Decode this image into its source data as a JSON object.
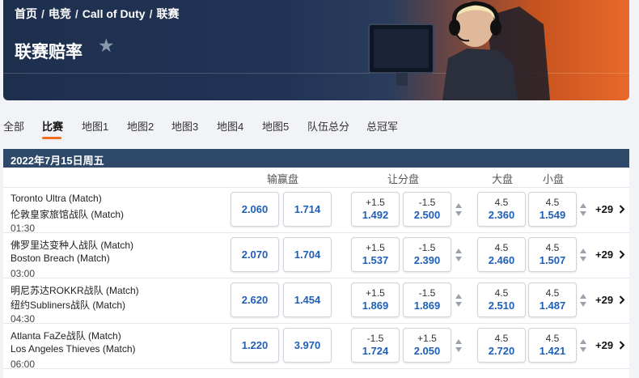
{
  "breadcrumb": [
    "首页",
    "电竞",
    "Call of Duty",
    "联赛"
  ],
  "breadcrumb_separator": "/",
  "page_title": "联赛赔率",
  "tabs": [
    "全部",
    "比赛",
    "地图1",
    "地图2",
    "地图3",
    "地图4",
    "地图5",
    "队伍总分",
    "总冠军"
  ],
  "active_tab": "比赛",
  "date_label": "2022年7月15日周五",
  "columns": {
    "moneyline": "输赢盘",
    "handicap": "让分盘",
    "over": "大盘",
    "under": "小盘"
  },
  "matches": [
    {
      "home": "Toronto Ultra (Match)",
      "away": "伦敦皇家旅馆战队 (Match)",
      "time": "01:30",
      "ml": [
        "2.060",
        "1.714"
      ],
      "hcp": [
        {
          "line": "+1.5",
          "odds": "1.492"
        },
        {
          "line": "-1.5",
          "odds": "2.500"
        }
      ],
      "over": {
        "line": "4.5",
        "odds": "2.360"
      },
      "under": {
        "line": "4.5",
        "odds": "1.549"
      },
      "more": "+29"
    },
    {
      "home": "佛罗里达变种人战队 (Match)",
      "away": "Boston Breach (Match)",
      "time": "03:00",
      "ml": [
        "2.070",
        "1.704"
      ],
      "hcp": [
        {
          "line": "+1.5",
          "odds": "1.537"
        },
        {
          "line": "-1.5",
          "odds": "2.390"
        }
      ],
      "over": {
        "line": "4.5",
        "odds": "2.460"
      },
      "under": {
        "line": "4.5",
        "odds": "1.507"
      },
      "more": "+29"
    },
    {
      "home": "明尼苏达ROKKR战队 (Match)",
      "away": "纽约Subliners战队 (Match)",
      "time": "04:30",
      "ml": [
        "2.620",
        "1.454"
      ],
      "hcp": [
        {
          "line": "+1.5",
          "odds": "1.869"
        },
        {
          "line": "-1.5",
          "odds": "1.869"
        }
      ],
      "over": {
        "line": "4.5",
        "odds": "2.510"
      },
      "under": {
        "line": "4.5",
        "odds": "1.487"
      },
      "more": "+29"
    },
    {
      "home": "Atlanta FaZe战队 (Match)",
      "away": "Los Angeles Thieves (Match)",
      "time": "06:00",
      "ml": [
        "1.220",
        "3.970"
      ],
      "hcp": [
        {
          "line": "-1.5",
          "odds": "1.724"
        },
        {
          "line": "+1.5",
          "odds": "2.050"
        }
      ],
      "over": {
        "line": "4.5",
        "odds": "2.720"
      },
      "under": {
        "line": "4.5",
        "odds": "1.421"
      },
      "more": "+29"
    }
  ],
  "colors": {
    "accent": "#f26b21",
    "odds": "#1f5fb8",
    "header_bar": "#2e4869",
    "hero": "#213456"
  }
}
